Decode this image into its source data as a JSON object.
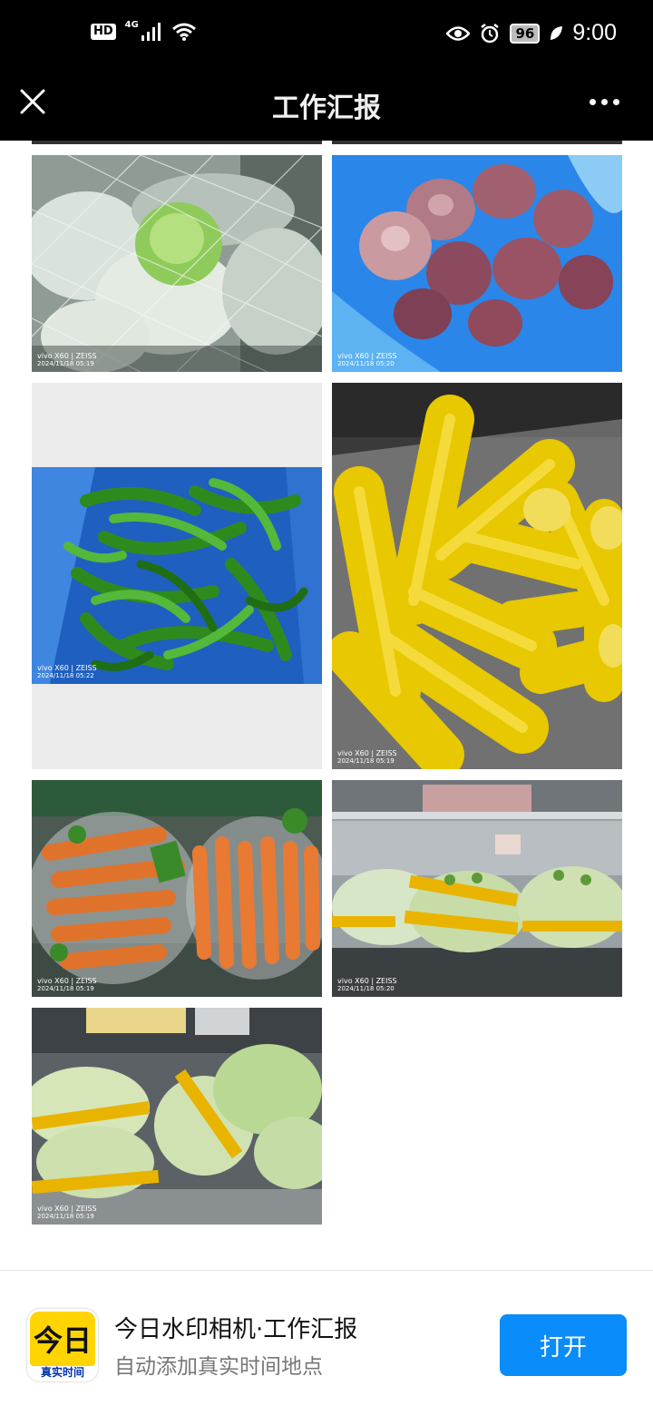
{
  "status_bar": {
    "hd": "HD",
    "network": "4G",
    "battery": "96",
    "time": "9:00",
    "icons": [
      "signal-icon",
      "wifi-icon",
      "eye-icon",
      "alarm-icon",
      "battery-icon",
      "leaf-icon"
    ]
  },
  "nav": {
    "title": "工作汇报",
    "close_icon": "close-icon",
    "more_icon": "more-dots-icon"
  },
  "photos": [
    {
      "subject": "cabbage",
      "wm_brand": "vivo X60 | ZEISS",
      "wm_date": "2024/11/18 05:19"
    },
    {
      "subject": "onions",
      "wm_brand": "vivo X60 | ZEISS",
      "wm_date": "2024/11/18 05:20"
    },
    {
      "subject": "green peppers",
      "wm_brand": "vivo X60 | ZEISS",
      "wm_date": "2024/11/18 05:22"
    },
    {
      "subject": "corn",
      "wm_brand": "vivo X60 | ZEISS",
      "wm_date": "2024/11/18 05:19"
    },
    {
      "subject": "carrots",
      "wm_brand": "vivo X60 | ZEISS",
      "wm_date": "2024/11/18 05:19"
    },
    {
      "subject": "napa cabbage in fridge",
      "wm_brand": "vivo X60 | ZEISS",
      "wm_date": "2024/11/18 05:20"
    },
    {
      "subject": "napa cabbage on counter",
      "wm_brand": "vivo X60 | ZEISS",
      "wm_date": "2024/11/18 05:19"
    }
  ],
  "banner": {
    "icon_main": "今日",
    "icon_sub": "真实时间",
    "title": "今日水印相机·工作汇报",
    "subtitle": "自动添加真实时间地点",
    "open_label": "打开"
  },
  "colors": {
    "accent": "#0a8cfa",
    "brand_yellow": "#ffd400",
    "bar_bg": "#000000"
  }
}
